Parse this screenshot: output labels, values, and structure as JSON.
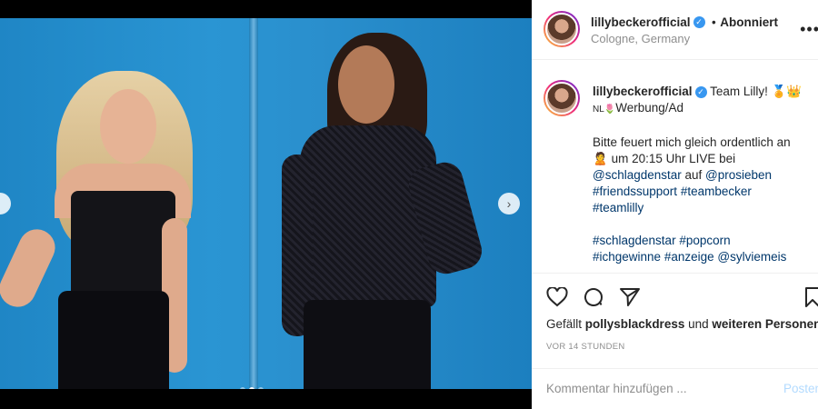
{
  "post": {
    "username": "lillybeckerofficial",
    "follow_status": "Abonniert",
    "separator": "•",
    "location": "Cologne, Germany"
  },
  "caption": {
    "username": "lillybeckerofficial",
    "title": "Team Lilly!",
    "title_emoji": "🏅👑",
    "ad_prefix": "NL🌷",
    "ad_label": "Werbung/Ad",
    "line1": "Bitte feuert mich gleich ordentlich an",
    "line2_emoji": "🙎",
    "line2": " um 20:15 Uhr LIVE bei",
    "mention1": "@schlagdenstar",
    "connector": " auf ",
    "mention2": "@prosieben",
    "tag1": "#friendssupport",
    "tag2": "#teambecker",
    "tag3": "#teamlilly",
    "tag4": "#schlagdenstar",
    "tag5": "#popcorn",
    "tag6": "#ichgewinne",
    "tag7": "#anzeige",
    "mention3": "@sylviemeis"
  },
  "likes": {
    "prefix": "Gefällt ",
    "user": "pollysblackdress",
    "middle": " und ",
    "others": "weiteren Personen"
  },
  "time": "VOR 14 STUNDEN",
  "comment": {
    "placeholder": "Kommentar hinzufügen ...",
    "post_label": "Posten"
  },
  "carousel": {
    "count": 3,
    "active": 2
  },
  "icons": [
    "heart-icon",
    "comment-icon",
    "share-icon",
    "bookmark-icon",
    "chevron-right-icon",
    "more-icon",
    "verified-icon"
  ],
  "colors": {
    "accent": "#3897f0",
    "link": "#00376b",
    "backdrop": "#2a8fcd"
  }
}
